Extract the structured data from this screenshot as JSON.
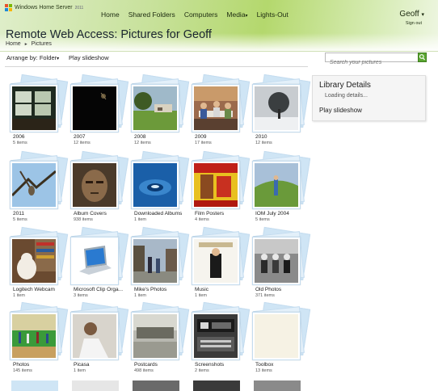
{
  "app": {
    "brand": "Windows Home Server",
    "brand_version": "2011"
  },
  "nav": {
    "items": [
      "Home",
      "Shared Folders",
      "Computers",
      "Media",
      "Lights-Out"
    ],
    "media_caret": "▾"
  },
  "user": {
    "name": "Geoff",
    "caret": "▾",
    "signout": "Sign out"
  },
  "page": {
    "title": "Remote Web Access: Pictures for Geoff",
    "breadcrumb": [
      "Home",
      "Pictures"
    ],
    "breadcrumb_sep": "►"
  },
  "toolbar": {
    "arrange_label": "Arrange by: Folder",
    "arrange_caret": "▾",
    "slideshow_label": "Play slideshow",
    "search_placeholder": "Search your pictures"
  },
  "details": {
    "title": "Library Details",
    "loading": "Loading details...",
    "slideshow": "Play slideshow"
  },
  "folders": [
    {
      "name": "2006",
      "count": "5 items",
      "icon": "window-photo"
    },
    {
      "name": "2007",
      "count": "12 items",
      "icon": "dark-photo"
    },
    {
      "name": "2008",
      "count": "12 items",
      "icon": "garden-photo"
    },
    {
      "name": "2009",
      "count": "17 items",
      "icon": "people-photo"
    },
    {
      "name": "2010",
      "count": "12 items",
      "icon": "snow-tree-photo"
    },
    {
      "name": "2011",
      "count": "5 items",
      "icon": "owl-photo"
    },
    {
      "name": "Album Covers",
      "count": "938 items",
      "icon": "face-photo"
    },
    {
      "name": "Downloaded Albums",
      "count": "1 item",
      "icon": "water-photo"
    },
    {
      "name": "Film Posters",
      "count": "4 items",
      "icon": "poster-photo"
    },
    {
      "name": "IOM July 2004",
      "count": "5 items",
      "icon": "hill-photo"
    },
    {
      "name": "Logitech Webcam",
      "count": "1 item",
      "icon": "dog-photo"
    },
    {
      "name": "Microsoft Clip Orga...",
      "count": "3 items",
      "icon": "laptop-photo"
    },
    {
      "name": "Mike's Photos",
      "count": "1 item",
      "icon": "street-photo"
    },
    {
      "name": "Music",
      "count": "1 item",
      "icon": "album-photo"
    },
    {
      "name": "Old Photos",
      "count": "371 items",
      "icon": "bw-photo"
    },
    {
      "name": "Photos",
      "count": "145 items",
      "icon": "gym-photo"
    },
    {
      "name": "Picasa",
      "count": "1 item",
      "icon": "man-photo"
    },
    {
      "name": "Postcards",
      "count": "498 items",
      "icon": "postcard-photo"
    },
    {
      "name": "Screenshots",
      "count": "2 items",
      "icon": "screen-photo"
    },
    {
      "name": "Toolbox",
      "count": "13 items",
      "icon": "blank-photo"
    }
  ],
  "colors": {
    "accent_green": "#5aa630",
    "stack_blue": "#cfe5f5"
  }
}
